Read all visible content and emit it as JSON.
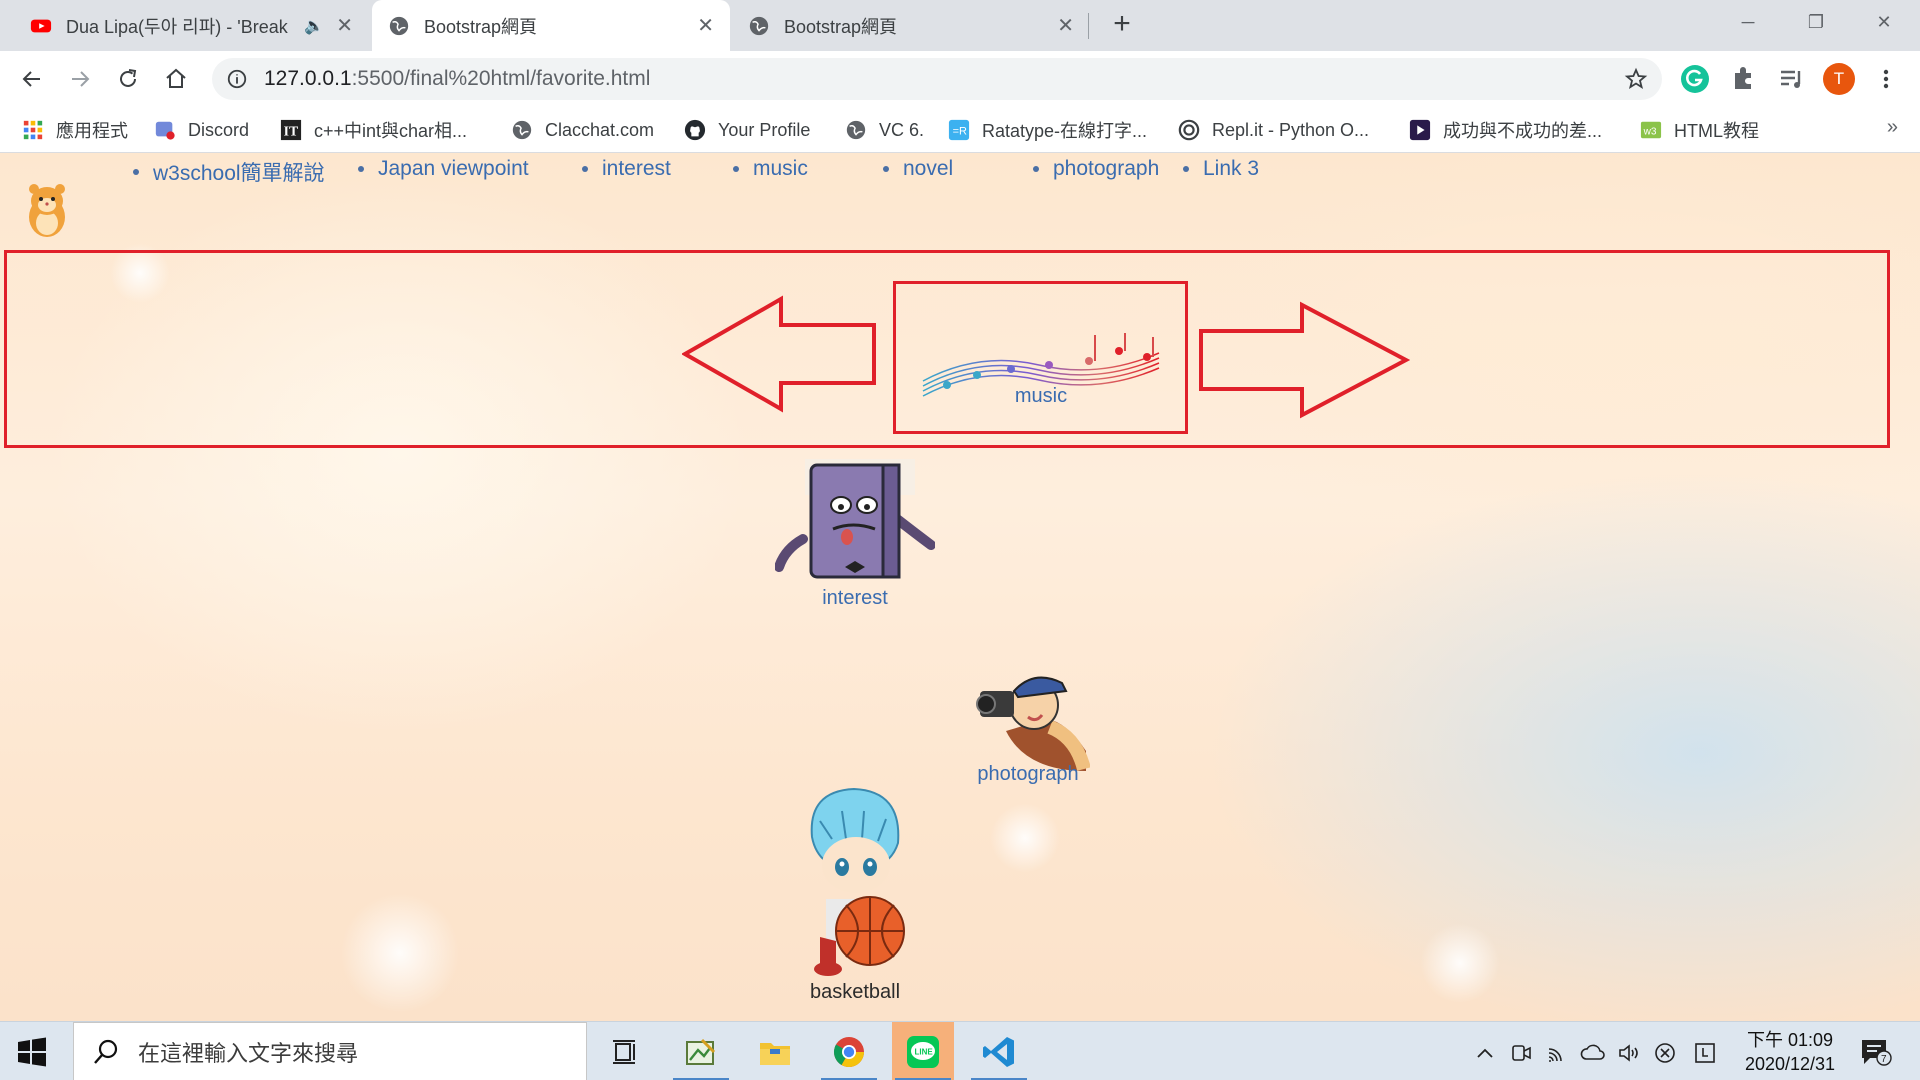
{
  "browser": {
    "tabs": [
      {
        "title": "Dua Lipa(두아 리파) - 'Break",
        "icon": "youtube-icon",
        "audio": "🔈"
      },
      {
        "title": "Bootstrap網頁",
        "icon": "globe-icon"
      },
      {
        "title": "Bootstrap網頁",
        "icon": "globe-icon"
      }
    ],
    "new_tab": "+",
    "address": {
      "host": "127.0.0.1",
      "path": ":5500/final%20html/favorite.html"
    },
    "profile_initial": "T",
    "bookmarks": [
      {
        "label": "應用程式",
        "icon": "apps-grid-icon"
      },
      {
        "label": "Discord",
        "icon": "discord-icon"
      },
      {
        "label": "c++中int與char相...",
        "icon": "ithome-icon"
      },
      {
        "label": "Clacchat.com",
        "icon": "globe-icon"
      },
      {
        "label": "Your Profile",
        "icon": "github-icon"
      },
      {
        "label": "VC 6.",
        "icon": "globe-icon"
      },
      {
        "label": "Ratatype-在線打字...",
        "icon": "ratatype-icon"
      },
      {
        "label": "Repl.it - Python O...",
        "icon": "replit-icon"
      },
      {
        "label": "成功與不成功的差...",
        "icon": "video-icon"
      },
      {
        "label": "HTML教程",
        "icon": "w3-icon"
      }
    ],
    "bookmarks_more": "»"
  },
  "page": {
    "nav": [
      "w3school簡單解說",
      "Japan viewpoint",
      "interest",
      "music",
      "novel",
      "photograph",
      "Link 3"
    ],
    "cards": {
      "music": "music",
      "interest": "interest",
      "photograph": "photograph",
      "basketball": "basketball"
    }
  },
  "taskbar": {
    "search_placeholder": "在這裡輸入文字來搜尋",
    "clock_time": "下午 01:09",
    "clock_date": "2020/12/31",
    "notification_count": "7"
  },
  "colors": {
    "link": "#3a6cb0",
    "highlight_box": "#e0202a",
    "taskbar": "#dde6ef"
  }
}
